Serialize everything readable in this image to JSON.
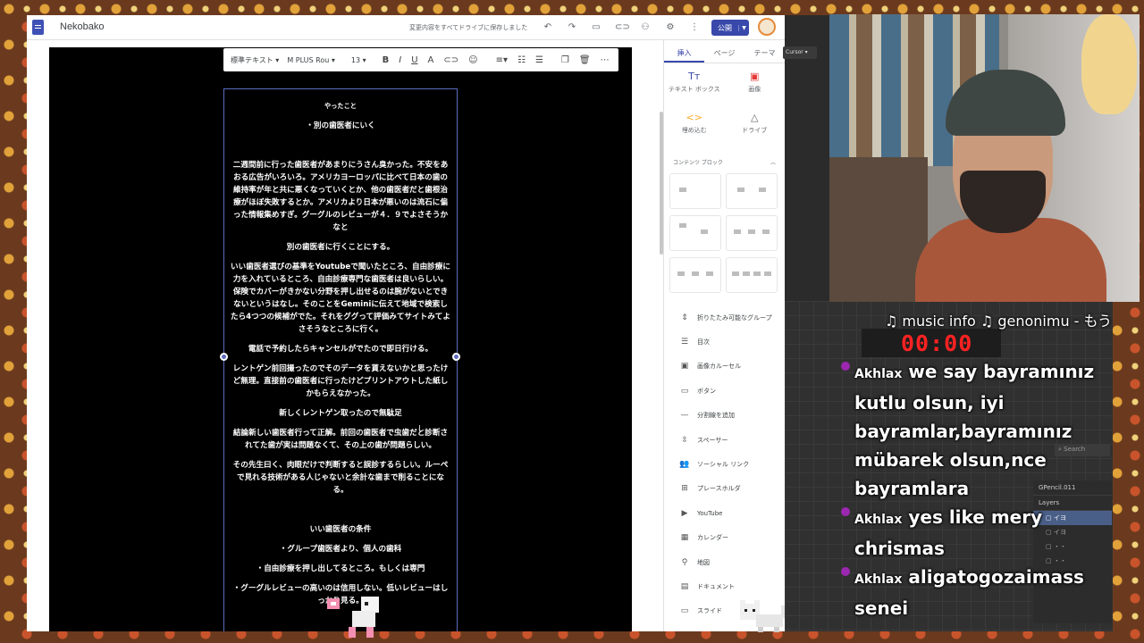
{
  "sites": {
    "title": "Nekobako",
    "save_status": "変更内容をすべてドライブに保存しました",
    "publish_label": "公開",
    "toolbar": {
      "style": "標準テキスト",
      "font": "M PLUS Rou",
      "size": "13"
    },
    "content": {
      "heading_small": "やったこと",
      "lines": [
        "・別の歯医者にいく",
        "二週間前に行った歯医者があまりにうさん臭かった。不安をあおる広告がいろいろ。アメリカヨーロッパに比べて日本の歯の維持率が年と共に悪くなっていくとか、他の歯医者だと歯根治療がほぼ失敗するとか。アメリカより日本が悪いのは流石に偏った情報集めすぎ。グーグルのレビューが４．９でよさそうかなと",
        "別の歯医者に行くことにする。",
        "いい歯医者選びの基準をYoutubeで聞いたところ、自由診療に力を入れているところ、自由診療専門な歯医者は良いらしい。保険でカバーがきかない分野を押し出せるのは腕がないとできないというはなし。そのことをGeminiに伝えて地域で検索したら4つつの候補がでた。それをググって評価みてサイトみてよさそうなところに行く。",
        "電話で予約したらキャンセルがでたので即日行ける。",
        "レントゲン前回撮ったのでそのデータを貰えないかと思ったけど無理。直接前の歯医者に行ったけどプリントアウトした紙しかもらえなかった。",
        "新しくレントゲン取ったので無駄足",
        "結論新しい歯医者行って正解。前回の歯医者で虫歯だと診断されてた歯が実は問題なくて、その上の歯が問題らしい。",
        "その先生曰く、肉眼だけで判断すると誤診するらしい。ルーペで見れる技術がある人じゃないと余計な歯まで削ることになる。"
      ],
      "conditions_title": "いい歯医者の条件",
      "conditions": [
        "・グループ歯医者より、個人の歯科",
        "・自由診療を押し出してるところ。もしくは専門",
        "・グーグルレビューの高いのは信用しない。低いレビューはしっかり見る。"
      ]
    },
    "panel": {
      "tabs": [
        "挿入",
        "ページ",
        "テーマ"
      ],
      "insert_items": [
        "テキスト ボックス",
        "画像",
        "埋め込む",
        "ドライブ"
      ],
      "content_blocks_label": "コンテンツ ブロック",
      "components": [
        "折りたたみ可能なグループ",
        "目次",
        "画像カルーセル",
        "ボタン",
        "分割線を追加",
        "スペーサー",
        "ソーシャル リンク",
        "プレースホルダ",
        "YouTube",
        "カレンダー",
        "地図",
        "ドキュメント",
        "スライド"
      ]
    }
  },
  "side_app": {
    "cursor_label": "Cursor",
    "search_placeholder": "Search",
    "object_name": "GPencil.011",
    "layers_label": "Layers"
  },
  "overlay": {
    "music_info": "♫ music info ♫ genonimu - もう",
    "timer": "00:00",
    "chat": [
      {
        "user": "Akhlax",
        "text": "we say bayramınız kutlu olsun, iyi bayramlar,bayramınız mübarek olsun,nce bayramlara"
      },
      {
        "user": "Akhlax",
        "text": "yes like mery chrismas"
      },
      {
        "user": "Akhlax",
        "text": "aligatogozaimass senei"
      }
    ]
  },
  "colors": {
    "accent": "#3949ab",
    "selection": "#5c6bc0",
    "timer": "#ff2222"
  }
}
